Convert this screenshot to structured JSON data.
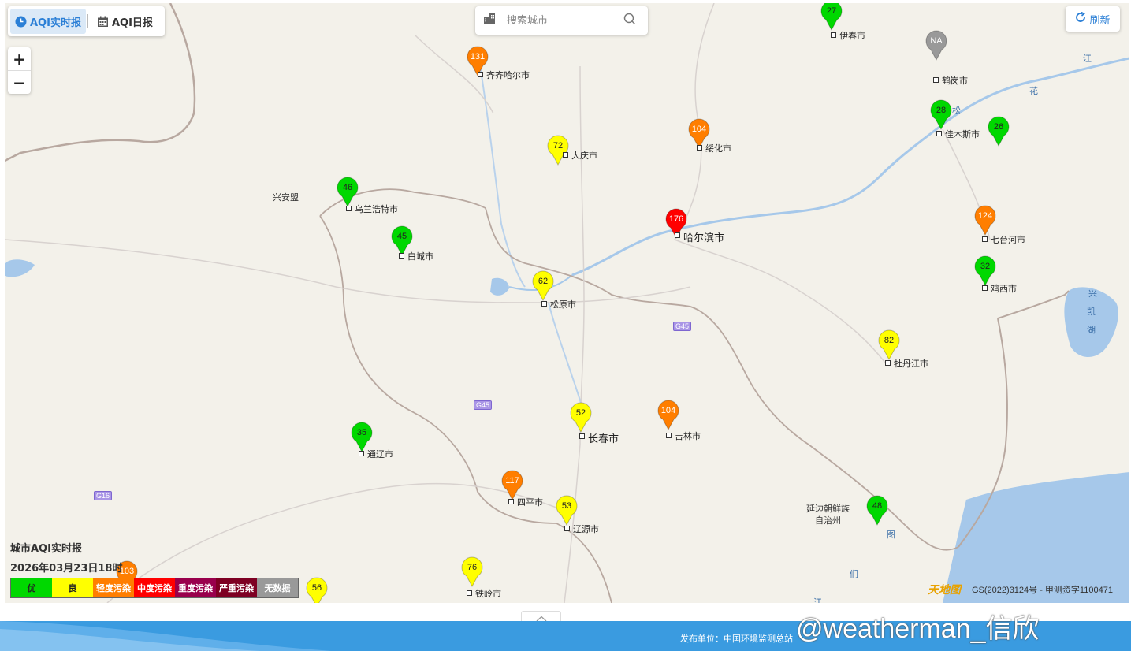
{
  "tabs": [
    {
      "label": "AQI实时报",
      "icon": "clock-icon",
      "active": true
    },
    {
      "label": "AQI日报",
      "icon": "calendar-icon",
      "active": false
    }
  ],
  "search": {
    "placeholder": "搜索城市",
    "icon": "search-icon"
  },
  "refresh": {
    "label": "刷新",
    "icon": "refresh-icon"
  },
  "zoom": {
    "in": "+",
    "out": "−"
  },
  "colors": {
    "good": "#00d800",
    "moderate": "#ffff00",
    "light": "#ff7e00",
    "medium": "#ff0000",
    "heavy": "#99004c",
    "severe": "#7e0023",
    "nodata": "#999999"
  },
  "stations": [
    {
      "city": "伊春市",
      "aqi": "27",
      "level": "good"
    },
    {
      "city": "鹤岗市",
      "aqi": "NA",
      "level": "nodata"
    },
    {
      "city": "齐齐哈尔市",
      "aqi": "131",
      "level": "light"
    },
    {
      "city": "佳木斯市",
      "aqi": "28",
      "level": "good"
    },
    {
      "city": "",
      "aqi": "26",
      "level": "good"
    },
    {
      "city": "绥化市",
      "aqi": "104",
      "level": "light"
    },
    {
      "city": "大庆市",
      "aqi": "72",
      "level": "moderate"
    },
    {
      "city": "乌兰浩特市",
      "aqi": "46",
      "level": "good"
    },
    {
      "city": "白城市",
      "aqi": "45",
      "level": "good"
    },
    {
      "city": "哈尔滨市",
      "aqi": "176",
      "level": "medium"
    },
    {
      "city": "七台河市",
      "aqi": "124",
      "level": "light"
    },
    {
      "city": "鸡西市",
      "aqi": "32",
      "level": "good"
    },
    {
      "city": "松原市",
      "aqi": "62",
      "level": "moderate"
    },
    {
      "city": "牡丹江市",
      "aqi": "82",
      "level": "moderate"
    },
    {
      "city": "长春市",
      "aqi": "52",
      "level": "moderate"
    },
    {
      "city": "吉林市",
      "aqi": "104",
      "level": "light"
    },
    {
      "city": "通辽市",
      "aqi": "35",
      "level": "good"
    },
    {
      "city": "四平市",
      "aqi": "117",
      "level": "light"
    },
    {
      "city": "辽源市",
      "aqi": "53",
      "level": "moderate"
    },
    {
      "city": "",
      "aqi": "48",
      "level": "good"
    },
    {
      "city": "铁岭市",
      "aqi": "76",
      "level": "moderate"
    },
    {
      "city": "",
      "aqi": "103",
      "level": "light"
    },
    {
      "city": "",
      "aqi": "56",
      "level": "moderate"
    }
  ],
  "map_labels": {
    "xinganmeng": "兴安盟",
    "yanbian1": "延边朝鲜族",
    "yanbian2": "自治州",
    "xing": "兴",
    "kai": "凯",
    "hu": "湖",
    "jiang1": "江",
    "hua": "花",
    "song": "松",
    "tu": "图",
    "men": "们",
    "jiang2": "江"
  },
  "roads": [
    "G45",
    "G45",
    "G16"
  ],
  "legend": {
    "title": "城市AQI实时报",
    "time": "2026年03月23日18时",
    "items": [
      "优",
      "良",
      "轻度污染",
      "中度污染",
      "重度污染",
      "严重污染",
      "无数据"
    ]
  },
  "gs": "GS(2022)3124号 - 甲测资字1100471",
  "logo_text": "天地图",
  "footer": {
    "publisher": "发布单位：中国环境监测总站"
  },
  "watermark": "@weatherman_信欣"
}
